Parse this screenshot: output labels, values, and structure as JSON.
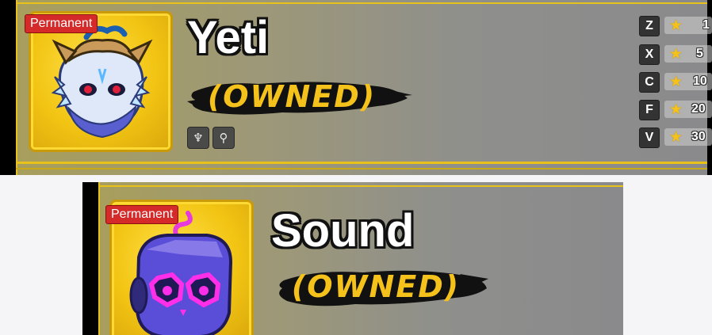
{
  "cards": [
    {
      "badge": "Permanent",
      "name": "Yeti",
      "status": "(OWNED)",
      "skill_icons": [
        "flame-crest-icon",
        "scythe-icon"
      ],
      "moves": [
        {
          "key": "Z",
          "mastery": "1"
        },
        {
          "key": "X",
          "mastery": "5"
        },
        {
          "key": "C",
          "mastery": "10"
        },
        {
          "key": "F",
          "mastery": "20"
        },
        {
          "key": "V",
          "mastery": "30"
        }
      ]
    },
    {
      "badge": "Permanent",
      "name": "Sound",
      "status": "(OWNED)"
    }
  ],
  "colors": {
    "accent_gold": "#e8c21a",
    "badge_red": "#d42a2a",
    "owned_yellow": "#f5c21c"
  }
}
